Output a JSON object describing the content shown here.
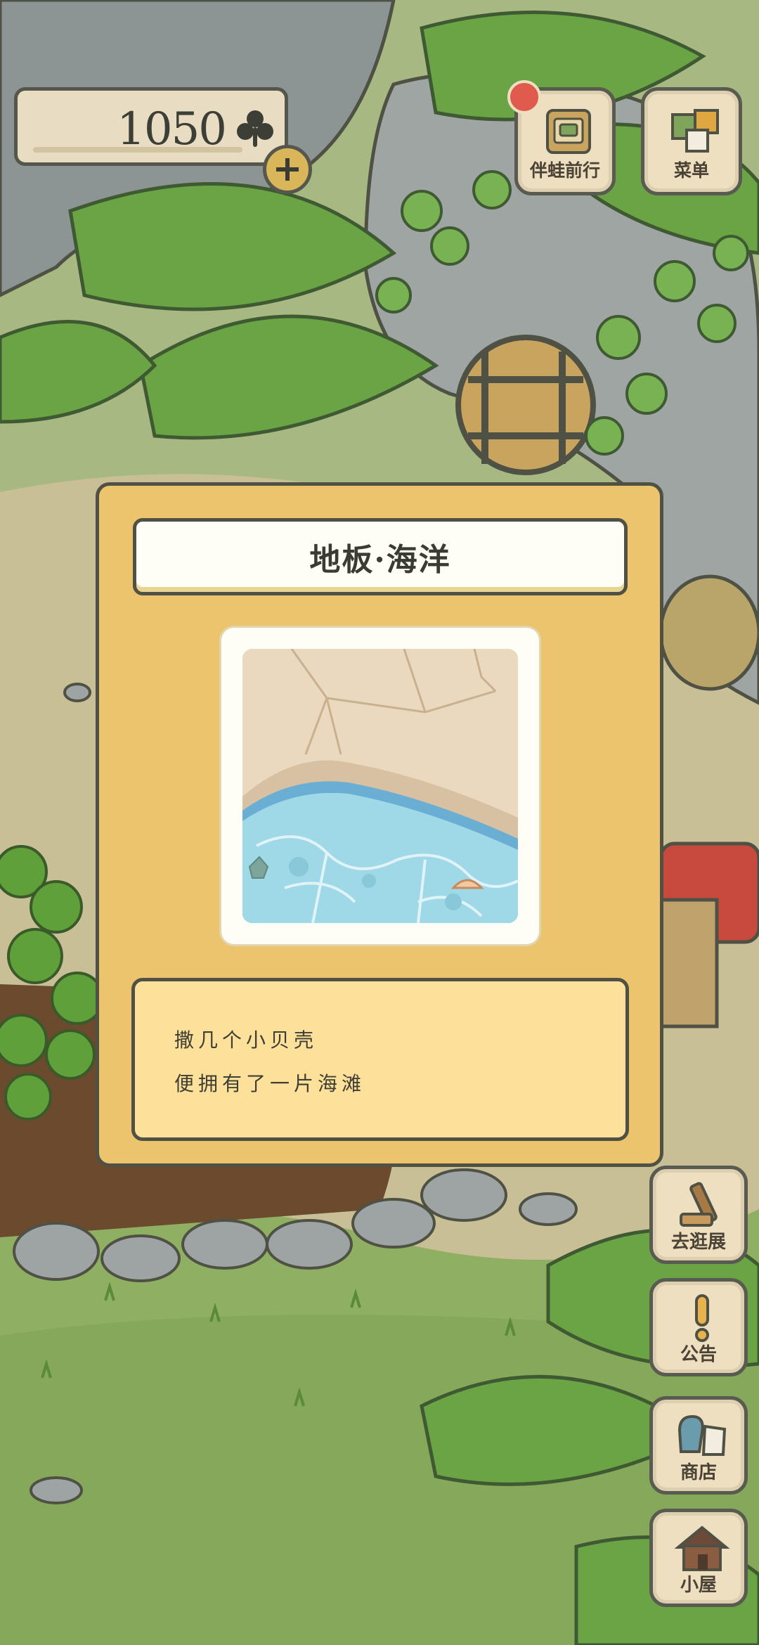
{
  "hud": {
    "clover_count": "1050",
    "clover_icon": "clover-icon",
    "add_icon": "plus-icon"
  },
  "top_buttons": [
    {
      "label": "伴蛙前行",
      "icon": "travel-bag-icon",
      "has_badge": true
    },
    {
      "label": "菜单",
      "icon": "menu-papers-icon"
    }
  ],
  "side_buttons": [
    {
      "label": "去逛展",
      "icon": "mallet-icon"
    },
    {
      "label": "公告",
      "icon": "exclamation-icon"
    },
    {
      "label": "商店",
      "icon": "shop-bags-icon"
    },
    {
      "label": "小屋",
      "icon": "house-icon"
    }
  ],
  "modal": {
    "title": "地板·海洋",
    "image_icon": "ocean-floor-preview",
    "description": [
      "撒几个小贝壳",
      "便拥有了一片海滩"
    ]
  },
  "colors": {
    "modal_bg": "#ecc46d",
    "desc_bg": "#fde19a",
    "badge": "#e05a4d",
    "grass": "#7fa55a"
  }
}
